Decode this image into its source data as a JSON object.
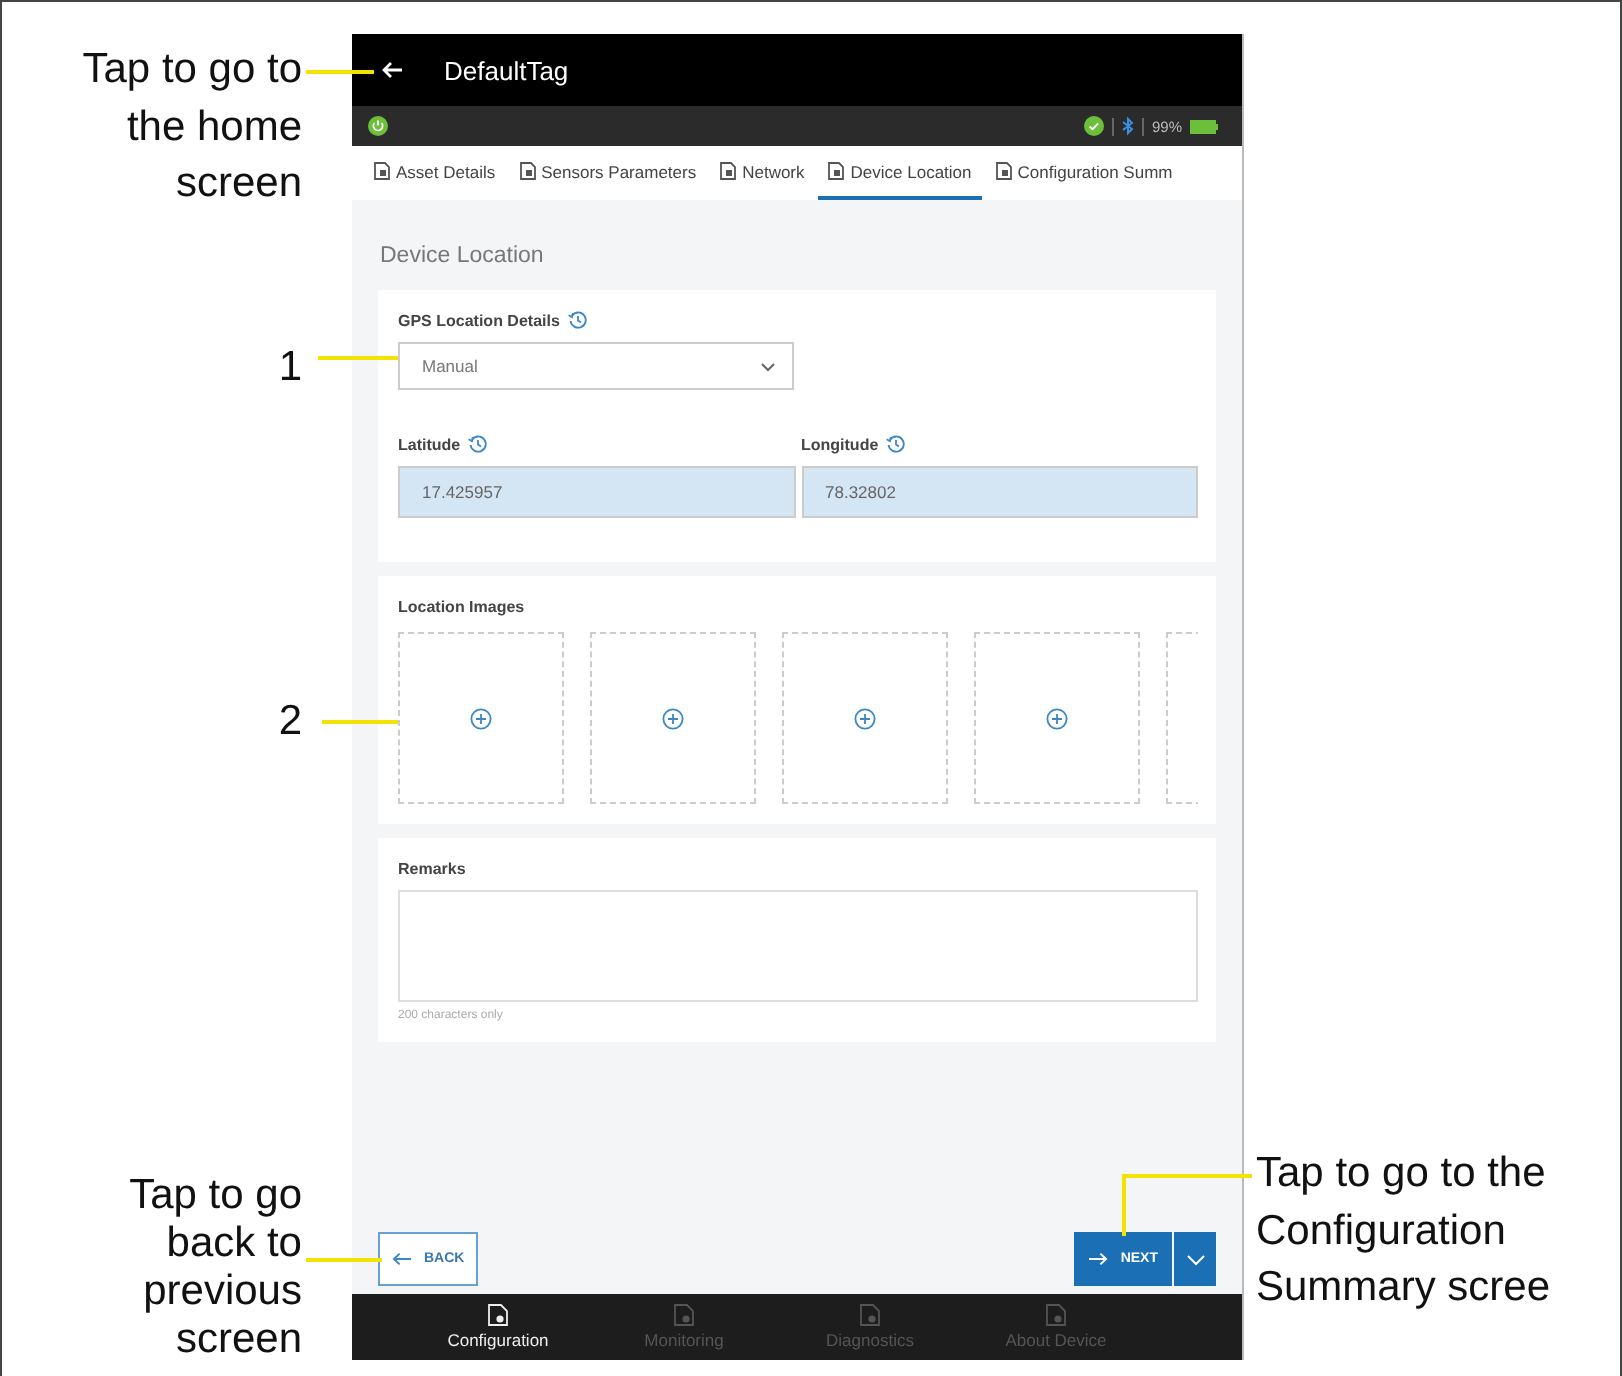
{
  "app_bar": {
    "title": "DefaultTag"
  },
  "status_bar": {
    "battery": "99%"
  },
  "tabs": [
    {
      "label": "Asset Details",
      "selected": false
    },
    {
      "label": "Sensors Parameters",
      "selected": false
    },
    {
      "label": "Network",
      "selected": false
    },
    {
      "label": "Device Location",
      "selected": true
    },
    {
      "label": "Configuration Summ",
      "selected": false
    }
  ],
  "page_title": "Device Location",
  "gps": {
    "label": "GPS Location Details",
    "value": "Manual"
  },
  "coordinates": [
    {
      "label": "Latitude",
      "value": "17.425957"
    },
    {
      "label": "Longitude",
      "value": "78.32802"
    }
  ],
  "location_images": {
    "label": "Location Images",
    "slots": [
      {
        "kind": "add"
      },
      {
        "kind": "add"
      },
      {
        "kind": "add"
      },
      {
        "kind": "add"
      },
      {
        "kind": "partial"
      }
    ]
  },
  "remarks": {
    "label": "Remarks",
    "hint": "200 characters only"
  },
  "buttons": {
    "back": "BACK",
    "next": "NEXT"
  },
  "bottom_nav": [
    {
      "label": "Configuration",
      "selected": true
    },
    {
      "label": "Monitoring",
      "selected": false
    },
    {
      "label": "Diagnostics",
      "selected": false
    },
    {
      "label": "About Device",
      "selected": false
    }
  ],
  "callouts": [
    {
      "lines": [
        "Tap to go to",
        "the home",
        "screen"
      ]
    },
    {
      "lines": [
        "1"
      ]
    },
    {
      "lines": [
        "2"
      ]
    },
    {
      "lines": [
        "Tap to go",
        "back to",
        "previous",
        "screen"
      ]
    },
    {
      "lines": [
        "Tap to go to the",
        "Configuration",
        "Summary scree"
      ]
    }
  ]
}
